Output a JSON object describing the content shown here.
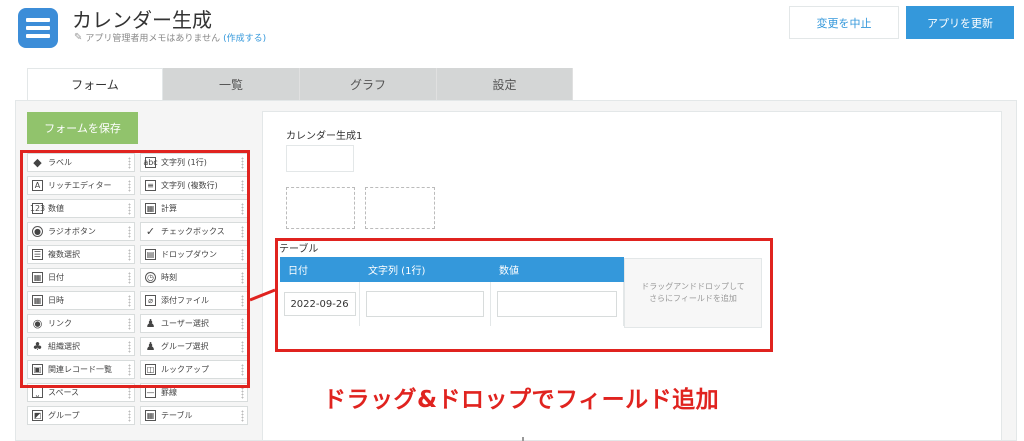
{
  "header": {
    "title": "カレンダー生成",
    "memo_text": "アプリ管理者用メモはありません",
    "memo_link": "(作成する)",
    "cancel_label": "変更を中止",
    "update_label": "アプリを更新"
  },
  "tabs": [
    {
      "label": "フォーム",
      "active": true
    },
    {
      "label": "一覧"
    },
    {
      "label": "グラフ"
    },
    {
      "label": "設定"
    }
  ],
  "save_label": "フォームを保存",
  "palette": [
    [
      {
        "label": "ラベル",
        "icon": "label-tag-icon",
        "glyph": "◆"
      },
      {
        "label": "文字列 (1行)",
        "icon": "single-line-text-icon",
        "glyph": "abc"
      }
    ],
    [
      {
        "label": "リッチエディター",
        "icon": "rich-editor-icon",
        "glyph": "A"
      },
      {
        "label": "文字列 (複数行)",
        "icon": "multi-line-text-icon",
        "glyph": "≡"
      }
    ],
    [
      {
        "label": "数値",
        "icon": "number-icon",
        "glyph": "123"
      },
      {
        "label": "計算",
        "icon": "calculator-icon",
        "glyph": "▦"
      }
    ],
    [
      {
        "label": "ラジオボタン",
        "icon": "radio-button-icon",
        "glyph": "●"
      },
      {
        "label": "チェックボックス",
        "icon": "checkbox-icon",
        "glyph": "✓"
      }
    ],
    [
      {
        "label": "複数選択",
        "icon": "multi-select-icon",
        "glyph": "☰"
      },
      {
        "label": "ドロップダウン",
        "icon": "dropdown-icon",
        "glyph": "▤"
      }
    ],
    [
      {
        "label": "日付",
        "icon": "date-calendar-icon",
        "glyph": "▦"
      },
      {
        "label": "時刻",
        "icon": "clock-icon",
        "glyph": "◷"
      }
    ],
    [
      {
        "label": "日時",
        "icon": "datetime-calendar-icon",
        "glyph": "▦"
      },
      {
        "label": "添付ファイル",
        "icon": "paperclip-icon",
        "glyph": "⌀"
      }
    ],
    [
      {
        "label": "リンク",
        "icon": "globe-link-icon",
        "glyph": "◉"
      },
      {
        "label": "ユーザー選択",
        "icon": "user-icon",
        "glyph": "♟"
      }
    ],
    [
      {
        "label": "組織選択",
        "icon": "org-chart-icon",
        "glyph": "♣"
      },
      {
        "label": "グループ選択",
        "icon": "group-users-icon",
        "glyph": "♟"
      }
    ],
    [
      {
        "label": "関連レコード一覧",
        "icon": "related-records-icon",
        "glyph": "▣"
      },
      {
        "label": "ルックアップ",
        "icon": "lookup-icon",
        "glyph": "◫"
      }
    ],
    [
      {
        "label": "スペース",
        "icon": "space-icon",
        "glyph": "⎵"
      },
      {
        "label": "罫線",
        "icon": "border-line-icon",
        "glyph": "—"
      }
    ],
    [
      {
        "label": "グループ",
        "icon": "group-folder-icon",
        "glyph": "◩"
      },
      {
        "label": "テーブル",
        "icon": "table-icon",
        "glyph": "▦"
      }
    ]
  ],
  "canvas": {
    "field_label": "カレンダー生成1",
    "table_title": "テーブル",
    "columns": [
      {
        "header": "日付",
        "value": "2022-09-26"
      },
      {
        "header": "文字列 (1行)",
        "value": ""
      },
      {
        "header": "数値",
        "value": ""
      }
    ],
    "drop_text_line1": "ドラッグアンドドロップして",
    "drop_text_line2": "さらにフィールドを追加"
  },
  "caption": "ドラッグ&ドロップでフィールド追加",
  "colors": {
    "accent_blue": "#3498db",
    "save_green": "#91c36c",
    "highlight_red": "#e0231f"
  }
}
